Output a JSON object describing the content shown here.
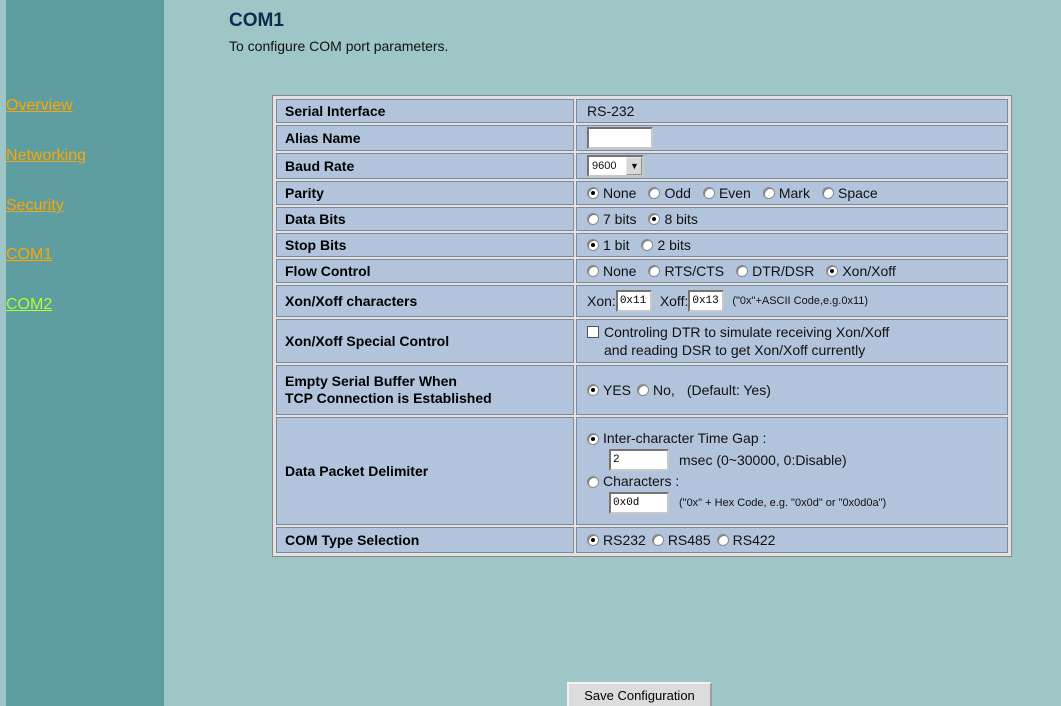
{
  "sidebar": {
    "items": [
      {
        "label": "Overview"
      },
      {
        "label": "Networking"
      },
      {
        "label": "Security"
      },
      {
        "label": "COM1"
      },
      {
        "label": "COM2"
      }
    ]
  },
  "header": {
    "title": "COM1",
    "subtitle": "To configure COM port parameters."
  },
  "form": {
    "serial_interface": {
      "label": "Serial Interface",
      "value": "RS-232"
    },
    "alias_name": {
      "label": "Alias Name",
      "value": ""
    },
    "baud_rate": {
      "label": "Baud Rate",
      "value": "9600"
    },
    "parity": {
      "label": "Parity",
      "options": [
        "None",
        "Odd",
        "Even",
        "Mark",
        "Space"
      ],
      "selected": "None"
    },
    "data_bits": {
      "label": "Data Bits",
      "options": [
        "7 bits",
        "8 bits"
      ],
      "selected": "8 bits"
    },
    "stop_bits": {
      "label": "Stop Bits",
      "options": [
        "1 bit",
        "2 bits"
      ],
      "selected": "1 bit"
    },
    "flow_control": {
      "label": "Flow Control",
      "options": [
        "None",
        "RTS/CTS",
        "DTR/DSR",
        "Xon/Xoff"
      ],
      "selected": "Xon/Xoff"
    },
    "xon_xoff_chars": {
      "label": "Xon/Xoff characters",
      "xon_label": "Xon:",
      "xon_value": "0x11",
      "xoff_label": "Xoff:",
      "xoff_value": "0x13",
      "hint": "(\"0x\"+ASCII Code,e.g.0x11)"
    },
    "xon_xoff_special": {
      "label": "Xon/Xoff Special Control",
      "checkbox_line1": "Controling DTR to simulate receiving Xon/Xoff",
      "checkbox_line2": "and reading DSR to get Xon/Xoff currently",
      "checked": false
    },
    "empty_buffer": {
      "label_line1": "Empty Serial Buffer When",
      "label_line2": "TCP Connection is Established",
      "options": [
        "YES",
        "No,"
      ],
      "selected": "YES",
      "default_text": "(Default: Yes)"
    },
    "packet_delimiter": {
      "label": "Data Packet Delimiter",
      "option_time_gap": "Inter-character Time Gap :",
      "time_gap_value": "2",
      "time_gap_unit": "msec (0~30000, 0:Disable)",
      "option_chars": "Characters :",
      "chars_value": "0x0d",
      "chars_hint": "(\"0x\" + Hex Code, e.g. \"0x0d\" or \"0x0d0a\")",
      "selected": "Inter-character Time Gap :"
    },
    "com_type": {
      "label": "COM Type Selection",
      "options": [
        "RS232",
        "RS485",
        "RS422"
      ],
      "selected": "RS232"
    }
  },
  "actions": {
    "save_label": "Save Configuration"
  },
  "colors": {
    "background": "#9fc6c6",
    "sidebar": "#5e9ea0",
    "cell": "#b1c4db",
    "nav_orange": "#ffa500",
    "nav_green": "#adff2f",
    "title": "#0c2d4d"
  }
}
